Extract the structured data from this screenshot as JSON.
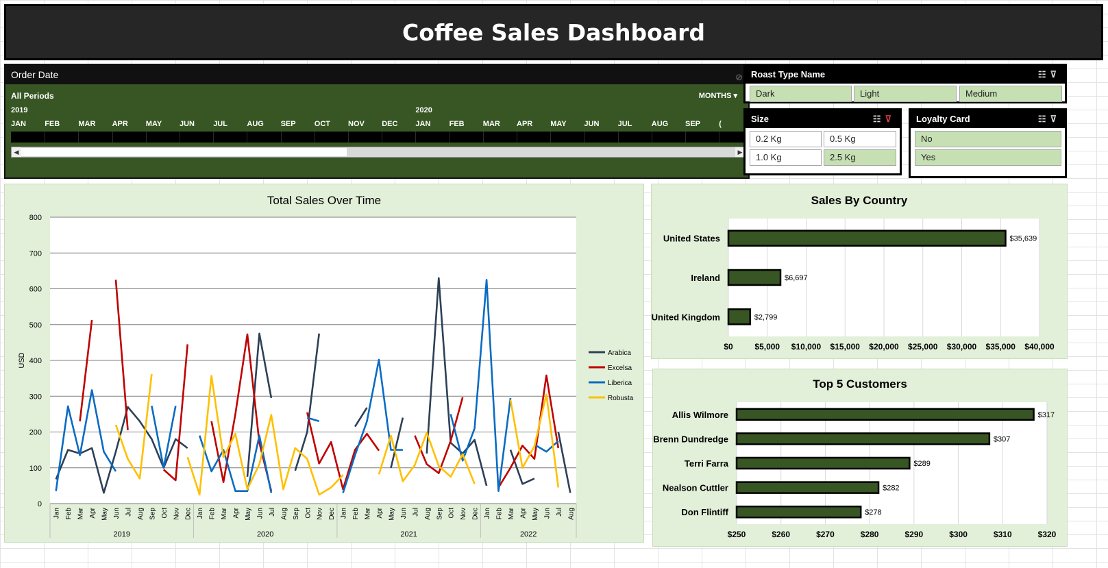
{
  "title": "Coffee Sales Dashboard",
  "timeline": {
    "header": "Order Date",
    "periods_label": "All Periods",
    "mode_label": "MONTHS ▾",
    "years": [
      "2019",
      "2020"
    ],
    "months": [
      "JAN",
      "FEB",
      "MAR",
      "APR",
      "MAY",
      "JUN",
      "JUL",
      "AUG",
      "SEP",
      "OCT",
      "NOV",
      "DEC",
      "JAN",
      "FEB",
      "MAR",
      "APR",
      "MAY",
      "JUN",
      "JUL",
      "AUG",
      "SEP",
      "("
    ],
    "clear_icon": "filter-clear-icon"
  },
  "slicers": {
    "roast": {
      "header": "Roast Type Name",
      "items": [
        {
          "label": "Dark",
          "selected": true
        },
        {
          "label": "Light",
          "selected": true
        },
        {
          "label": "Medium",
          "selected": true
        }
      ]
    },
    "size": {
      "header": "Size",
      "items": [
        {
          "label": "0.2 Kg",
          "selected": false
        },
        {
          "label": "0.5 Kg",
          "selected": false
        },
        {
          "label": "1.0 Kg",
          "selected": false
        },
        {
          "label": "2.5 Kg",
          "selected": true
        }
      ]
    },
    "loyalty": {
      "header": "Loyalty Card",
      "items": [
        {
          "label": "No",
          "selected": true
        },
        {
          "label": "Yes",
          "selected": true
        }
      ]
    }
  },
  "colors": {
    "Arabica": "#2e4057",
    "Excelsa": "#c00000",
    "Liberica": "#0a6cc2",
    "Robusta": "#ffc000",
    "bar_fill": "#375623",
    "panel_bg": "#e2efd9"
  },
  "chart_data": [
    {
      "type": "line",
      "title": "Total Sales Over Time",
      "ylabel": "USD",
      "ylim": [
        0,
        800
      ],
      "yticks": [
        0,
        100,
        200,
        300,
        400,
        500,
        600,
        700,
        800
      ],
      "grid": true,
      "legend": "right",
      "categories": [
        "Jan",
        "Feb",
        "Mar",
        "Apr",
        "May",
        "Jun",
        "Jul",
        "Aug",
        "Sep",
        "Oct",
        "Nov",
        "Dec",
        "Jan",
        "Feb",
        "Mar",
        "Apr",
        "May",
        "Jun",
        "Jul",
        "Aug",
        "Sep",
        "Oct",
        "Nov",
        "Dec",
        "Jan",
        "Feb",
        "Mar",
        "Apr",
        "May",
        "Jun",
        "Jul",
        "Aug",
        "Sep",
        "Oct",
        "Nov",
        "Dec",
        "Jan",
        "Feb",
        "Mar",
        "Apr",
        "May",
        "Jun",
        "Jul",
        "Aug"
      ],
      "groups": [
        {
          "label": "2019",
          "count": 12
        },
        {
          "label": "2020",
          "count": 12
        },
        {
          "label": "2021",
          "count": 12
        },
        {
          "label": "2022",
          "count": 8
        }
      ],
      "series": [
        {
          "name": "Arabica",
          "values": [
            68,
            150,
            140,
            155,
            30,
            145,
            270,
            230,
            180,
            100,
            180,
            155,
            null,
            null,
            null,
            null,
            75,
            475,
            295,
            null,
            92,
            200,
            475,
            null,
            null,
            215,
            268,
            null,
            100,
            240,
            null,
            140,
            630,
            170,
            140,
            178,
            50,
            null,
            150,
            55,
            70,
            null,
            200,
            30
          ]
        },
        {
          "name": "Excelsa",
          "values": [
            null,
            null,
            230,
            513,
            null,
            625,
            205,
            null,
            null,
            95,
            65,
            445,
            null,
            230,
            60,
            250,
            473,
            170,
            35,
            null,
            null,
            255,
            112,
            172,
            40,
            150,
            195,
            148,
            null,
            null,
            190,
            110,
            85,
            175,
            297,
            null,
            null,
            45,
            100,
            162,
            125,
            358,
            155,
            null
          ]
        },
        {
          "name": "Liberica",
          "values": [
            35,
            272,
            135,
            317,
            145,
            90,
            null,
            null,
            273,
            100,
            273,
            null,
            190,
            90,
            150,
            35,
            35,
            190,
            30,
            null,
            null,
            240,
            230,
            null,
            30,
            135,
            230,
            402,
            150,
            150,
            null,
            null,
            null,
            250,
            120,
            210,
            625,
            35,
            295,
            null,
            165,
            145,
            175,
            null
          ]
        },
        {
          "name": "Robusta",
          "values": [
            null,
            null,
            null,
            null,
            null,
            220,
            125,
            70,
            362,
            null,
            null,
            130,
            25,
            357,
            130,
            195,
            40,
            110,
            248,
            40,
            155,
            125,
            25,
            45,
            80,
            null,
            null,
            82,
            190,
            62,
            108,
            198,
            105,
            75,
            138,
            55,
            null,
            null,
            290,
            100,
            160,
            305,
            45,
            null
          ]
        }
      ]
    },
    {
      "type": "bar",
      "orientation": "horizontal",
      "title": "Sales By Country",
      "categories": [
        "United States",
        "Ireland",
        "United Kingdom"
      ],
      "values": [
        35639,
        6697,
        2799
      ],
      "value_labels": [
        "$35,639",
        "$6,697",
        "$2,799"
      ],
      "xlim": [
        0,
        40000
      ],
      "xticks": [
        "$0",
        "$5,000",
        "$10,000",
        "$15,000",
        "$20,000",
        "$25,000",
        "$30,000",
        "$35,000",
        "$40,000"
      ],
      "grid": true
    },
    {
      "type": "bar",
      "orientation": "horizontal",
      "title": "Top 5 Customers",
      "categories": [
        "Allis Wilmore",
        "Brenn Dundredge",
        "Terri Farra",
        "Nealson Cuttler",
        "Don Flintiff"
      ],
      "values": [
        317,
        307,
        289,
        282,
        278
      ],
      "value_labels": [
        "$317",
        "$307",
        "$289",
        "$282",
        "$278"
      ],
      "xlim": [
        250,
        320
      ],
      "xticks": [
        "$250",
        "$260",
        "$270",
        "$280",
        "$290",
        "$300",
        "$310",
        "$320"
      ],
      "grid": true
    }
  ]
}
